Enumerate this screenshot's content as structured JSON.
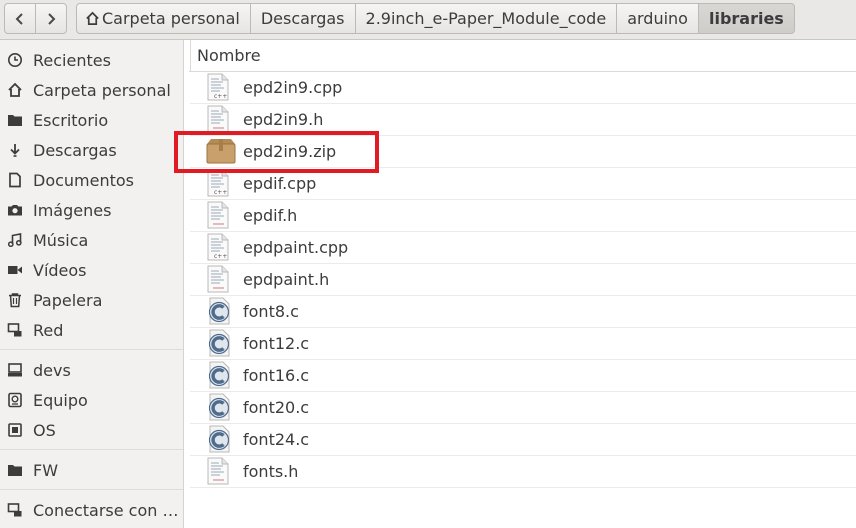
{
  "nav": {
    "back_icon": "chevron-left-icon",
    "forward_icon": "chevron-right-icon"
  },
  "breadcrumbs": [
    {
      "label": "Carpeta personal",
      "icon": "home-icon"
    },
    {
      "label": "Descargas"
    },
    {
      "label": "2.9inch_e-Paper_Module_code"
    },
    {
      "label": "arduino"
    },
    {
      "label": "libraries",
      "active": true
    }
  ],
  "sidebar": {
    "items": [
      {
        "label": "Recientes",
        "icon": "clock-icon"
      },
      {
        "label": "Carpeta personal",
        "icon": "home-icon"
      },
      {
        "label": "Escritorio",
        "icon": "folder-icon"
      },
      {
        "label": "Descargas",
        "icon": "download-icon"
      },
      {
        "label": "Documentos",
        "icon": "document-icon"
      },
      {
        "label": "Imágenes",
        "icon": "camera-icon"
      },
      {
        "label": "Música",
        "icon": "music-icon"
      },
      {
        "label": "Vídeos",
        "icon": "video-icon"
      },
      {
        "label": "Papelera",
        "icon": "trash-icon"
      },
      {
        "label": "Red",
        "icon": "network-icon"
      },
      {
        "label": "devs",
        "icon": "drive-icon"
      },
      {
        "label": "Equipo",
        "icon": "disk-icon"
      },
      {
        "label": "OS",
        "icon": "chip-icon"
      },
      {
        "label": "FW",
        "icon": "folder-icon"
      },
      {
        "label": "Conectarse con …",
        "icon": "connect-icon"
      }
    ]
  },
  "files": {
    "column_header": "Nombre",
    "items": [
      {
        "name": "epd2in9.cpp",
        "icon": "cpp-file-icon"
      },
      {
        "name": "epd2in9.h",
        "icon": "header-file-icon"
      },
      {
        "name": "epd2in9.zip",
        "icon": "archive-icon"
      },
      {
        "name": "epdif.cpp",
        "icon": "cpp-file-icon"
      },
      {
        "name": "epdif.h",
        "icon": "header-file-icon"
      },
      {
        "name": "epdpaint.cpp",
        "icon": "cpp-file-icon"
      },
      {
        "name": "epdpaint.h",
        "icon": "header-file-icon"
      },
      {
        "name": "font8.c",
        "icon": "c-file-icon"
      },
      {
        "name": "font12.c",
        "icon": "c-file-icon"
      },
      {
        "name": "font16.c",
        "icon": "c-file-icon"
      },
      {
        "name": "font20.c",
        "icon": "c-file-icon"
      },
      {
        "name": "font24.c",
        "icon": "c-file-icon"
      },
      {
        "name": "fonts.h",
        "icon": "header-file-icon"
      }
    ]
  },
  "colors": {
    "highlight": "#e01b24",
    "sidebar_bg": "#f2f1f0",
    "toolbar_bg": "#e9e8e6"
  }
}
